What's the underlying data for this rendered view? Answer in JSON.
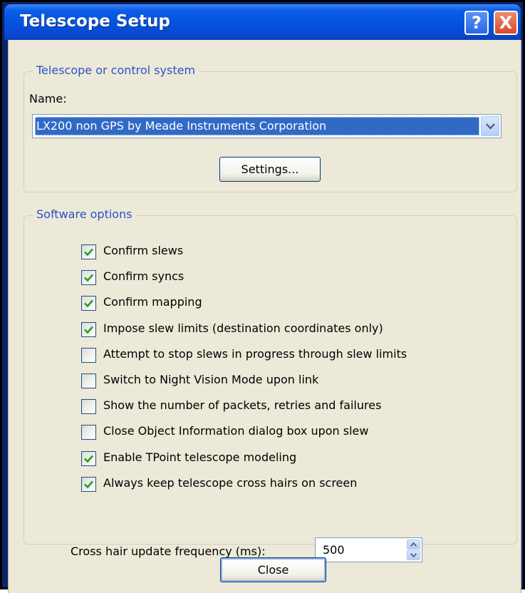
{
  "window": {
    "title": "Telescope Setup",
    "help_button": "?",
    "close_button": "X"
  },
  "telescope_group": {
    "legend": "Telescope or control system",
    "name_label": "Name:",
    "name_value": "LX200 non GPS by Meade Instruments Corporation",
    "settings_button": "Settings..."
  },
  "software_group": {
    "legend": "Software options",
    "options": [
      {
        "label": "Confirm slews",
        "checked": true
      },
      {
        "label": "Confirm syncs",
        "checked": true
      },
      {
        "label": "Confirm mapping",
        "checked": true
      },
      {
        "label": "Impose slew limits (destination coordinates only)",
        "checked": true
      },
      {
        "label": "Attempt to stop slews in progress through slew limits",
        "checked": false
      },
      {
        "label": "Switch to Night Vision Mode upon link",
        "checked": false
      },
      {
        "label": "Show the number of packets, retries and failures",
        "checked": false
      },
      {
        "label": "Close Object Information dialog box upon slew",
        "checked": false
      },
      {
        "label": "Enable TPoint telescope modeling",
        "checked": true
      },
      {
        "label": "Always keep telescope cross hairs on screen",
        "checked": true
      }
    ],
    "frequency_label": "Cross hair update frequency (ms):",
    "frequency_value": "500"
  },
  "footer": {
    "close_button": "Close"
  },
  "colors": {
    "title_bar": "#0651e0",
    "dialog_face": "#ece9d8",
    "legend_text": "#2a52c8",
    "selection": "#316ac5",
    "check_mark": "#21a121"
  }
}
